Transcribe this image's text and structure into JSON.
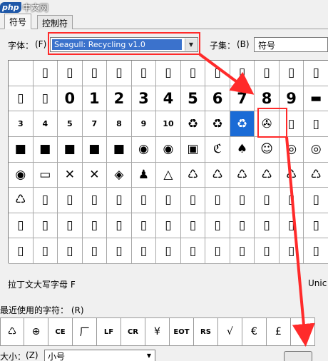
{
  "watermark": {
    "logo": "php",
    "text": "中文网"
  },
  "tabs": [
    {
      "label": "符号",
      "active": true
    },
    {
      "label": "控制符",
      "active": false
    }
  ],
  "font": {
    "label": "字体：",
    "hotkey": "(F)",
    "value": "Seagull: Recycling v1.0"
  },
  "subset": {
    "label": "子集：",
    "hotkey": "(B)",
    "value": "符号"
  },
  "grid": {
    "rows": [
      [
        "",
        "▯",
        "▯",
        "▯",
        "▯",
        "▯",
        "▯",
        "▯",
        "▯",
        "▯",
        "▯",
        "▯",
        "▯"
      ],
      [
        "▯",
        "▯",
        "0",
        "1",
        "2",
        "3",
        "4",
        "5",
        "6",
        "7",
        "8",
        "9",
        "▬"
      ],
      [
        "3",
        "4",
        "5",
        "7",
        "8",
        "9",
        "10",
        "♻",
        "♻",
        "♻",
        "✇",
        "▯",
        "▯"
      ],
      [
        "■",
        "■",
        "■",
        "■",
        "■",
        "◉",
        "◉",
        "▣",
        "ℭ",
        "♠",
        "☺",
        "◎",
        "◎"
      ],
      [
        "◉",
        "▭",
        "✕",
        "✕",
        "◈",
        "♟",
        "△",
        "♺",
        "♺",
        "♺",
        "♺",
        "♺",
        "♺"
      ],
      [
        "♺",
        "▯",
        "▯",
        "▯",
        "▯",
        "▯",
        "▯",
        "▯",
        "▯",
        "▯",
        "▯",
        "▯",
        "▯"
      ],
      [
        "▯",
        "▯",
        "▯",
        "▯",
        "▯",
        "▯",
        "▯",
        "▯",
        "▯",
        "▯",
        "▯",
        "▯",
        "▯"
      ],
      [
        "▯",
        "▯",
        "▯",
        "▯",
        "▯",
        "▯",
        "▯",
        "▯",
        "▯",
        "▯",
        "▯",
        "▯",
        "▯"
      ]
    ]
  },
  "char_description": "拉丁文大写字母 F",
  "char_description_right": "Unic",
  "recent": {
    "label": "最近使用的字符：",
    "hotkey": "(R)",
    "chars": [
      "♺",
      "⊕",
      "CE",
      "厂",
      "LF",
      "CR",
      "¥",
      "EOT",
      "RS",
      "√",
      "€",
      "£",
      "©"
    ]
  },
  "size": {
    "label": "大小：",
    "hotkey": "(Z)",
    "value": "小号"
  },
  "colors": {
    "selection": "#1a6bd6",
    "highlight": "#ff2a2a",
    "combo_selection": "#3b72cc"
  }
}
